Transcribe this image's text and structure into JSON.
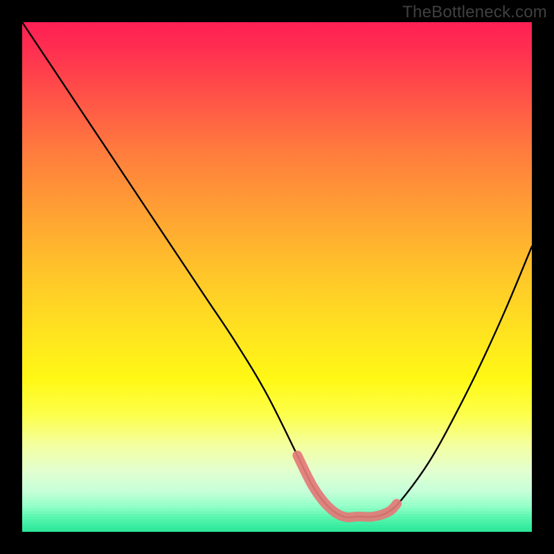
{
  "watermark": "TheBottleneck.com",
  "chart_data": {
    "type": "line",
    "title": "",
    "xlabel": "",
    "ylabel": "",
    "xlim": [
      0,
      100
    ],
    "ylim": [
      0,
      100
    ],
    "series": [
      {
        "name": "bottleneck-curve",
        "x": [
          0,
          6,
          12,
          18,
          24,
          30,
          36,
          42,
          48,
          54,
          57,
          60,
          63,
          66,
          69,
          72,
          75,
          80,
          85,
          90,
          95,
          100
        ],
        "values": [
          100,
          91,
          82,
          73,
          64,
          55,
          46,
          37,
          27,
          15,
          9,
          5,
          3,
          3,
          3,
          4,
          7,
          14,
          23,
          33,
          44,
          56
        ]
      }
    ],
    "highlight": {
      "name": "optimal-range",
      "x": [
        54,
        57,
        60,
        63,
        66,
        69,
        72,
        73.5
      ],
      "values": [
        15,
        9,
        5,
        3,
        3,
        3,
        4,
        5.5
      ]
    },
    "gradient_stops": [
      {
        "pos": 0.0,
        "color": "#ff1f55"
      },
      {
        "pos": 0.5,
        "color": "#ffc729"
      },
      {
        "pos": 0.8,
        "color": "#fdff4a"
      },
      {
        "pos": 1.0,
        "color": "#2ae597"
      }
    ]
  }
}
